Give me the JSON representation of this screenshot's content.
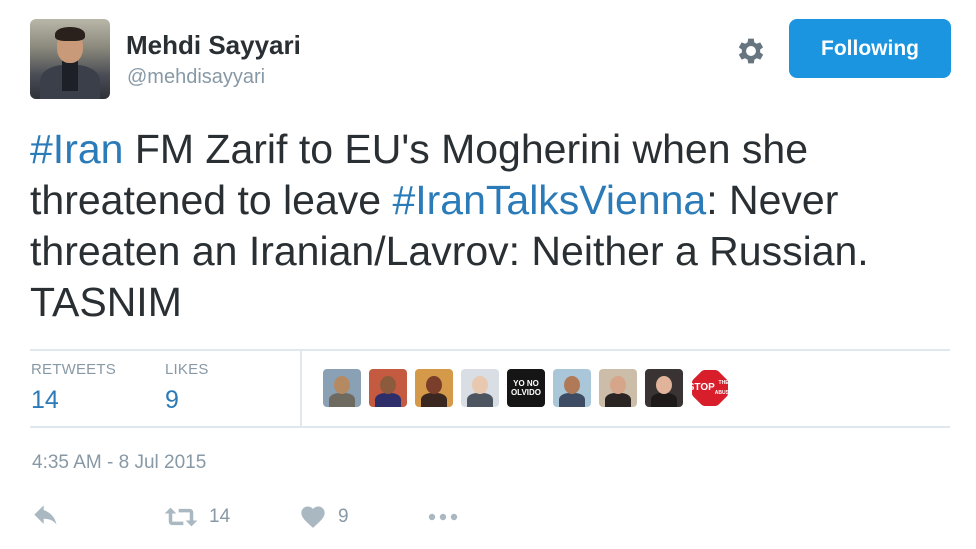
{
  "user": {
    "name": "Mehdi Sayyari",
    "handle": "@mehdisayyari"
  },
  "follow_button": {
    "label": "Following"
  },
  "tweet": {
    "parts": [
      {
        "text": "#Iran",
        "hashtag": true
      },
      {
        "text": " FM Zarif to EU's Mogherini when she threatened to leave ",
        "hashtag": false
      },
      {
        "text": "#IranTalksVienna",
        "hashtag": true
      },
      {
        "text": ": Never threaten an Iranian/Lavrov: Neither a Russian. TASNIM",
        "hashtag": false
      }
    ]
  },
  "stats": {
    "retweets_label": "RETWEETS",
    "retweets_value": "14",
    "likes_label": "LIKES",
    "likes_value": "9"
  },
  "likers": [
    {
      "kind": "photo",
      "bg": "#8aa0b5",
      "head": "#b58a62",
      "body": "#6e6a5f"
    },
    {
      "kind": "photo",
      "bg": "#c45a3f",
      "head": "#8c5a3c",
      "body": "#2e2f6a"
    },
    {
      "kind": "photo",
      "bg": "#d49a4a",
      "head": "#7a3e2a",
      "body": "#3a2820"
    },
    {
      "kind": "photo",
      "bg": "#d9dde4",
      "head": "#e8c9b0",
      "body": "#4d5660"
    },
    {
      "kind": "badge",
      "line1": "YO NO",
      "line2": "OLVIDO"
    },
    {
      "kind": "photo",
      "bg": "#a9c7d8",
      "head": "#b07a58",
      "body": "#3d4c63"
    },
    {
      "kind": "photo",
      "bg": "#cbbda8",
      "head": "#d6a58a",
      "body": "#2a2522"
    },
    {
      "kind": "photo",
      "bg": "#3a3334",
      "head": "#e0b39a",
      "body": "#1e1a1a"
    },
    {
      "kind": "stop",
      "line1": "STOP",
      "line2": "THE ABUSE"
    }
  ],
  "timestamp": "4:35 AM - 8 Jul 2015",
  "actions": {
    "retweet_count": "14",
    "like_count": "9"
  },
  "colors": {
    "brand_blue": "#1b95e0",
    "link_blue": "#2b7bb9",
    "muted": "#8899a6",
    "text": "#292f33"
  },
  "icons": [
    "gear-icon",
    "reply-icon",
    "retweet-icon",
    "heart-icon",
    "more-icon"
  ]
}
